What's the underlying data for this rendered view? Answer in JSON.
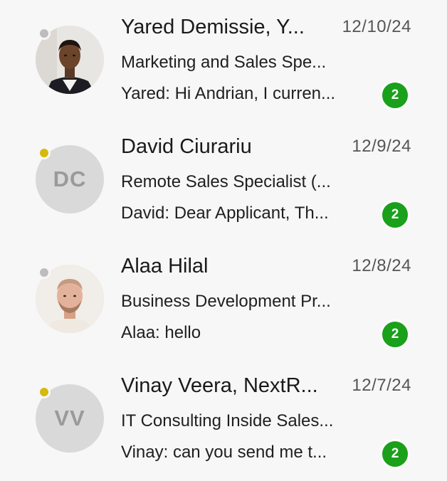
{
  "colors": {
    "badge": "#1aa01a",
    "presence_offline": "#bdbdbd",
    "presence_away": "#d7b90c",
    "initials_bg": "#d9d9d9",
    "initials_text": "#9a9a9a"
  },
  "conversations": [
    {
      "name": "Yared Demissie, Y...",
      "date": "12/10/24",
      "subtitle": "Marketing and Sales Spe...",
      "preview": "Yared: Hi Andrian, I curren...",
      "unread": "2",
      "presence": "offline",
      "avatar_type": "photo"
    },
    {
      "name": "David Ciurariu",
      "date": "12/9/24",
      "subtitle": "Remote Sales Specialist (...",
      "preview": "David: Dear Applicant, Th...",
      "unread": "2",
      "presence": "away",
      "avatar_type": "initials",
      "initials": "DC"
    },
    {
      "name": "Alaa Hilal",
      "date": "12/8/24",
      "subtitle": "Business Development Pr...",
      "preview": "Alaa: hello",
      "unread": "2",
      "presence": "offline",
      "avatar_type": "photo"
    },
    {
      "name": "Vinay Veera, NextR...",
      "date": "12/7/24",
      "subtitle": "IT Consulting Inside Sales...",
      "preview": "Vinay: can you send me t...",
      "unread": "2",
      "presence": "away",
      "avatar_type": "initials",
      "initials": "VV"
    }
  ]
}
